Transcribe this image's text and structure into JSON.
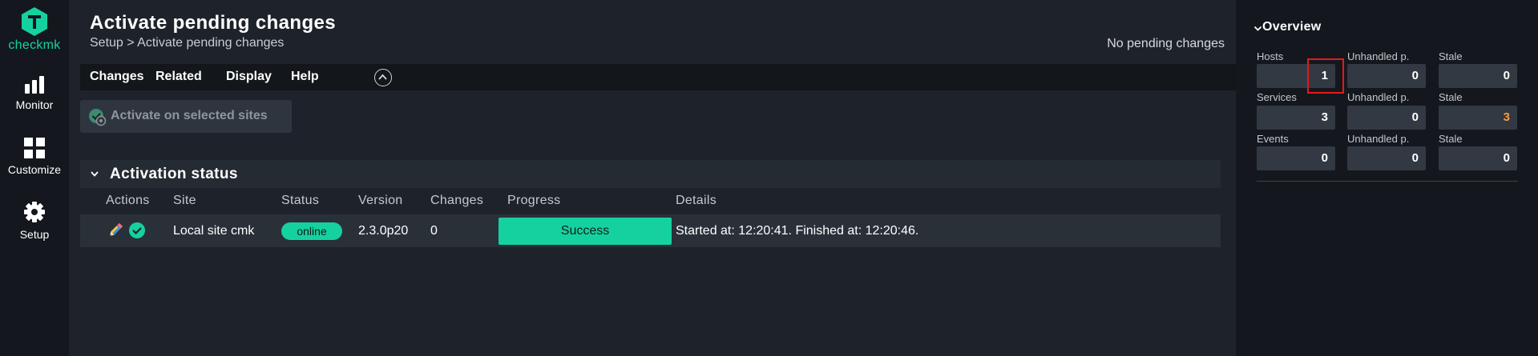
{
  "brand": {
    "name": "checkmk",
    "accent": "#15d1a0"
  },
  "sidenav": {
    "items": [
      {
        "label": "Monitor",
        "icon": "bar-chart-icon"
      },
      {
        "label": "Customize",
        "icon": "grid-icon"
      },
      {
        "label": "Setup",
        "icon": "gear-icon"
      }
    ]
  },
  "header": {
    "title": "Activate pending changes",
    "breadcrumb": "Setup > Activate pending changes",
    "pending_status": "No pending changes"
  },
  "menu": {
    "items": [
      "Changes",
      "Related",
      "Display",
      "Help"
    ]
  },
  "actions": {
    "activate_label": "Activate on selected sites"
  },
  "activation": {
    "title": "Activation status",
    "columns": [
      "Actions",
      "Site",
      "Status",
      "Version",
      "Changes",
      "Progress",
      "Details"
    ],
    "row": {
      "site": "Local site cmk",
      "status": "online",
      "version": "2.3.0p20",
      "changes": "0",
      "progress": "Success",
      "details": "Started at: 12:20:41. Finished at: 12:20:46."
    }
  },
  "overview": {
    "title": "Overview",
    "rows": [
      {
        "cells": [
          {
            "label": "Hosts",
            "value": "1"
          },
          {
            "label": "Unhandled p.",
            "value": "0"
          },
          {
            "label": "Stale",
            "value": "0"
          }
        ]
      },
      {
        "cells": [
          {
            "label": "Services",
            "value": "3"
          },
          {
            "label": "Unhandled p.",
            "value": "0"
          },
          {
            "label": "Stale",
            "value": "3"
          }
        ]
      },
      {
        "cells": [
          {
            "label": "Events",
            "value": "0"
          },
          {
            "label": "Unhandled p.",
            "value": "0"
          },
          {
            "label": "Stale",
            "value": "0"
          }
        ]
      }
    ],
    "warn_color": "#ff9b3b"
  },
  "colors": {
    "highlight": "#e51a1a",
    "success": "#15d1a0"
  }
}
